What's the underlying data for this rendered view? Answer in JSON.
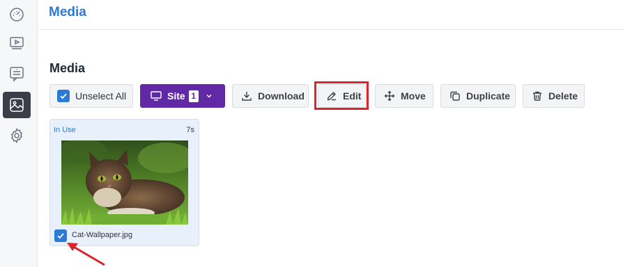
{
  "sidebar": {
    "items": [
      {
        "icon": "dashboard-gauge-icon",
        "active": false
      },
      {
        "icon": "video-player-icon",
        "active": false
      },
      {
        "icon": "message-board-icon",
        "active": false
      },
      {
        "icon": "media-image-icon",
        "active": true
      },
      {
        "icon": "gear-icon",
        "active": false
      }
    ]
  },
  "header": {
    "title": "Media"
  },
  "section": {
    "title": "Media"
  },
  "toolbar": {
    "unselect_label": "Unselect All",
    "site_label": "Site",
    "site_count": "1",
    "download_label": "Download",
    "edit_label": "Edit",
    "move_label": "Move",
    "duplicate_label": "Duplicate",
    "delete_label": "Delete"
  },
  "media_items": [
    {
      "status": "In Use",
      "duration": "7s",
      "filename": "Cat-Wallpaper.jpg",
      "selected": true
    }
  ],
  "colors": {
    "accent": "#2a7ad6",
    "site_button": "#6229a6",
    "highlight": "#d9262c"
  }
}
